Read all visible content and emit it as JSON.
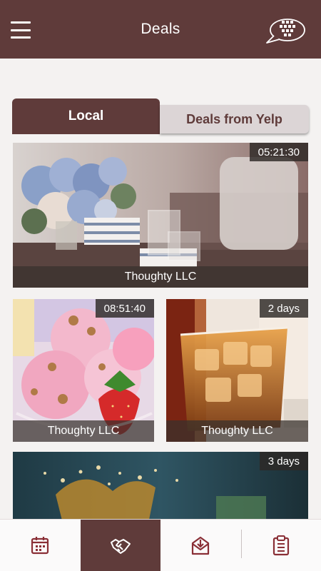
{
  "header": {
    "title": "Deals",
    "menu_icon": "hamburger-menu-icon",
    "chat_icon": "chat-bubble-icon"
  },
  "tabs": [
    {
      "label": "Local",
      "active": true
    },
    {
      "label": "Deals from Yelp",
      "active": false
    }
  ],
  "deals": [
    {
      "merchant": "Thoughty LLC",
      "time_left": "05:21:30",
      "image": "flowers-cups-table"
    },
    {
      "merchant": "Thoughty LLC",
      "time_left": "08:51:40",
      "image": "ice-cream-strawberry"
    },
    {
      "merchant": "Thoughty LLC",
      "time_left": "2 days",
      "image": "whiskey-on-ice"
    },
    {
      "merchant": "",
      "time_left": "3 days",
      "image": "drink-splash"
    }
  ],
  "bottom_nav": [
    {
      "icon": "calendar-icon",
      "active": false
    },
    {
      "icon": "handshake-icon",
      "active": true
    },
    {
      "icon": "envelope-download-icon",
      "active": false
    },
    {
      "icon": "clipboard-list-icon",
      "active": false
    }
  ],
  "colors": {
    "brand": "#5f3b3a",
    "tab_inactive": "#dcd5d6",
    "background": "#f4f2f1"
  }
}
